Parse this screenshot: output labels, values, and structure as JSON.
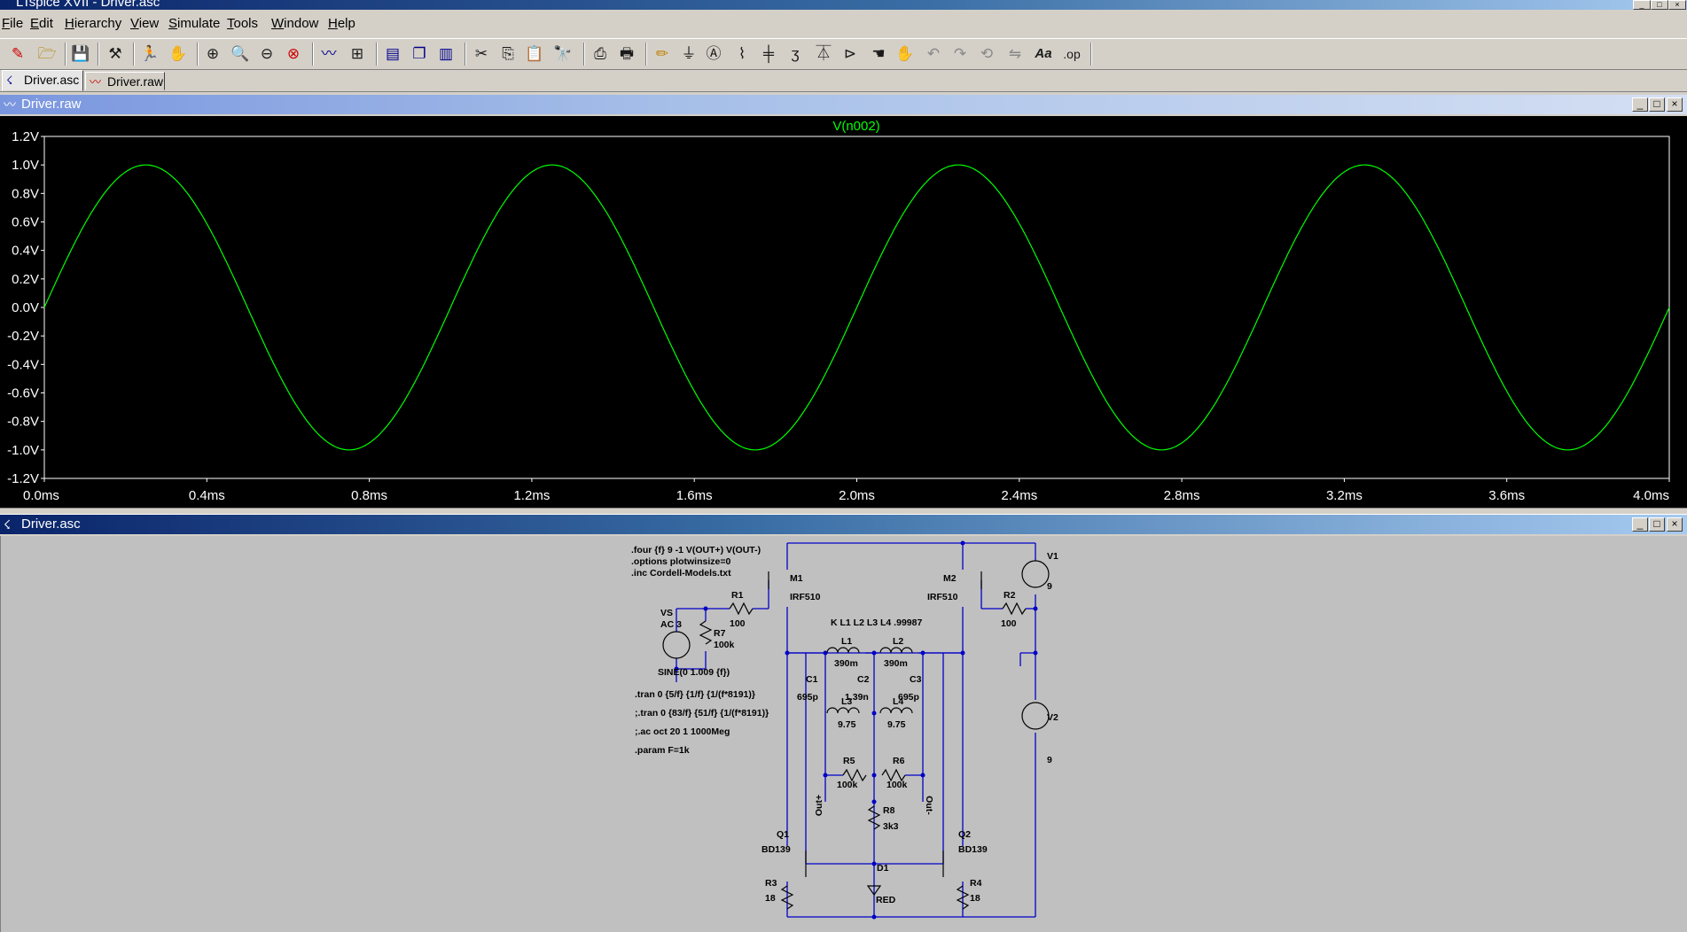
{
  "app": {
    "title": "LTspice XVII - Driver.asc",
    "window_buttons": [
      "_",
      "□",
      "×"
    ]
  },
  "menu": [
    {
      "label": "File"
    },
    {
      "label": "Edit"
    },
    {
      "label": "Hierarchy"
    },
    {
      "label": "View"
    },
    {
      "label": "Simulate"
    },
    {
      "label": "Tools"
    },
    {
      "label": "Window"
    },
    {
      "label": "Help"
    }
  ],
  "toolbar": {
    "tools": [
      {
        "icon": "new-schematic-icon",
        "glyph": "✎"
      },
      {
        "icon": "open-icon",
        "glyph": "🗁"
      },
      {
        "icon": "save-icon",
        "glyph": "💾"
      },
      {
        "icon": "control-panel-icon",
        "glyph": "⚒"
      },
      {
        "icon": "run-icon",
        "glyph": "🏃"
      },
      {
        "icon": "pan-icon",
        "glyph": "✋"
      },
      {
        "icon": "zoom-in-icon",
        "glyph": "⊕"
      },
      {
        "icon": "zoom-full-icon",
        "glyph": "🔍"
      },
      {
        "icon": "zoom-out-icon",
        "glyph": "⊖"
      },
      {
        "icon": "zoom-cancel-icon",
        "glyph": "⊗"
      },
      {
        "icon": "autorange-icon",
        "glyph": "〰"
      },
      {
        "icon": "grid-icon",
        "glyph": "⊞"
      },
      {
        "icon": "tile-horizontal-icon",
        "glyph": "▤"
      },
      {
        "icon": "cascade-icon",
        "glyph": "❐"
      },
      {
        "icon": "tile-vertical-icon",
        "glyph": "▥"
      },
      {
        "icon": "cut-icon",
        "glyph": "✂"
      },
      {
        "icon": "copy-icon",
        "glyph": "⎘"
      },
      {
        "icon": "paste-icon",
        "glyph": "📋"
      },
      {
        "icon": "find-icon",
        "glyph": "🔭"
      },
      {
        "icon": "print-preview-icon",
        "glyph": "⎙"
      },
      {
        "icon": "print-icon",
        "glyph": "🖶"
      },
      {
        "icon": "draw-wire-icon",
        "glyph": "✏"
      },
      {
        "icon": "ground-icon",
        "glyph": "⏚"
      },
      {
        "icon": "label-net-icon",
        "glyph": "Ⓐ"
      },
      {
        "icon": "resistor-icon",
        "glyph": "⌇"
      },
      {
        "icon": "capacitor-icon",
        "glyph": "╪"
      },
      {
        "icon": "inductor-icon",
        "glyph": "ʒ"
      },
      {
        "icon": "diode-icon",
        "glyph": "⏄"
      },
      {
        "icon": "component-icon",
        "glyph": "⊳"
      },
      {
        "icon": "move-icon",
        "glyph": "☚"
      },
      {
        "icon": "drag-icon",
        "glyph": "✋"
      },
      {
        "icon": "undo-icon",
        "glyph": "↶"
      },
      {
        "icon": "redo-icon",
        "glyph": "↷"
      },
      {
        "icon": "rotate-icon",
        "glyph": "⟲"
      },
      {
        "icon": "mirror-icon",
        "glyph": "⇋"
      },
      {
        "icon": "text-icon",
        "glyph": "Aa"
      },
      {
        "icon": "spice-directive-icon",
        "glyph": ".op"
      }
    ]
  },
  "tabs": [
    {
      "label": "Driver.asc",
      "icon": "schematic-icon",
      "active": true
    },
    {
      "label": "Driver.raw",
      "icon": "waveform-icon",
      "active": false
    }
  ],
  "plot_window": {
    "title": "Driver.raw",
    "trace_label": "V(n002)",
    "trace_color": "#00ff00",
    "background": "#000000",
    "axis_color": "#ffffff"
  },
  "chart_data": {
    "type": "line",
    "title": "V(n002)",
    "xlabel": "",
    "ylabel": "",
    "xlim": [
      0,
      4.0
    ],
    "ylim": [
      -1.2,
      1.2
    ],
    "x_ticks": [
      "0.0ms",
      "0.4ms",
      "0.8ms",
      "1.2ms",
      "1.6ms",
      "2.0ms",
      "2.4ms",
      "2.8ms",
      "3.2ms",
      "3.6ms",
      "4.0ms"
    ],
    "x_tick_values": [
      0,
      0.4,
      0.8,
      1.2,
      1.6,
      2.0,
      2.4,
      2.8,
      3.2,
      3.6,
      4.0
    ],
    "y_ticks": [
      "1.2V",
      "1.0V",
      "0.8V",
      "0.6V",
      "0.4V",
      "0.2V",
      "0.0V",
      "-0.2V",
      "-0.4V",
      "-0.6V",
      "-0.8V",
      "-1.0V",
      "-1.2V"
    ],
    "y_tick_values": [
      1.2,
      1.0,
      0.8,
      0.6,
      0.4,
      0.2,
      0.0,
      -0.2,
      -0.4,
      -0.6,
      -0.8,
      -1.0,
      -1.2
    ],
    "series": [
      {
        "name": "V(n002)",
        "color": "#00ff00",
        "x": [
          0,
          0.125,
          0.25,
          0.375,
          0.5,
          0.625,
          0.75,
          0.875,
          1.0,
          1.125,
          1.25,
          1.375,
          1.5,
          1.625,
          1.75,
          1.875,
          2.0,
          2.125,
          2.25,
          2.375,
          2.5,
          2.625,
          2.75,
          2.875,
          3.0,
          3.125,
          3.25,
          3.375,
          3.5,
          3.625,
          3.75,
          3.875,
          4.0
        ],
        "y": [
          0,
          0.707,
          1.0,
          0.707,
          0,
          -0.707,
          -1.0,
          -0.707,
          0,
          0.707,
          1.0,
          0.707,
          0,
          -0.707,
          -1.0,
          -0.707,
          0,
          0.707,
          1.0,
          0.707,
          0,
          -0.707,
          -1.0,
          -0.707,
          0,
          0.707,
          1.0,
          0.707,
          0,
          -0.707,
          -1.0,
          -0.707,
          0
        ]
      }
    ],
    "grid": false
  },
  "schematic_window": {
    "title": "Driver.asc",
    "directives_top": [
      ".four {f} 9 -1 V(OUT+) V(OUT-)",
      ".options plotwinsize=0",
      ".inc Cordell-Models.txt"
    ],
    "directives_bottom": [
      ".tran 0 {5/f} {1/f} {1/(f*8191)}",
      ";.tran 0 {83/f} {51/f} {1/(f*8191)}",
      ";.ac oct 20 1 1000Meg",
      ".param F=1k"
    ],
    "k_statement": "K L1 L2 L3 L4 .99987",
    "source_vs": {
      "name": "VS",
      "ac": "AC 3",
      "value": "SINE(0 1.009 {f})"
    },
    "components": [
      {
        "ref": "M1",
        "value": "IRF510"
      },
      {
        "ref": "M2",
        "value": "IRF510"
      },
      {
        "ref": "R1",
        "value": "100"
      },
      {
        "ref": "R2",
        "value": "100"
      },
      {
        "ref": "R7",
        "value": "100k"
      },
      {
        "ref": "V1",
        "value": "9"
      },
      {
        "ref": "V2",
        "value": "9"
      },
      {
        "ref": "L1",
        "value": "390m"
      },
      {
        "ref": "L2",
        "value": "390m"
      },
      {
        "ref": "L3",
        "value": "9.75"
      },
      {
        "ref": "L4",
        "value": "9.75"
      },
      {
        "ref": "C1",
        "value": "695p"
      },
      {
        "ref": "C2",
        "value": "1.39n"
      },
      {
        "ref": "C3",
        "value": "695p"
      },
      {
        "ref": "R5",
        "value": "100k"
      },
      {
        "ref": "R6",
        "value": "100k"
      },
      {
        "ref": "R8",
        "value": "3k3"
      },
      {
        "ref": "Q1",
        "value": "BD139"
      },
      {
        "ref": "Q2",
        "value": "BD139"
      },
      {
        "ref": "R3",
        "value": "18"
      },
      {
        "ref": "R4",
        "value": "18"
      },
      {
        "ref": "D1",
        "value": "RED"
      }
    ],
    "net_labels": [
      "Out+",
      "Out-"
    ],
    "wire_color": "#0000c8"
  }
}
